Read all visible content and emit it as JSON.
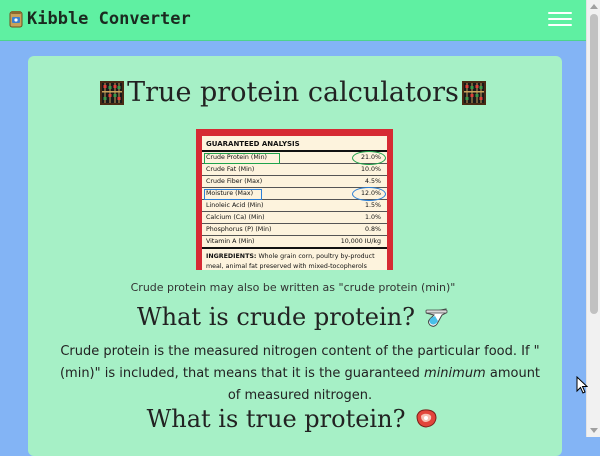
{
  "app": {
    "brand": "Kibble Converter",
    "brand_icon": "kibble-bag-icon",
    "menu_icon": "hamburger-menu-icon"
  },
  "colors": {
    "background": "#83b4f5",
    "navbar": "#5ff0a2",
    "card": "#a6f0c6",
    "label_border": "#d62a33",
    "highlight_green": "#1fa24b",
    "highlight_blue": "#2b7fd6"
  },
  "main": {
    "title": "True protein calculators",
    "title_icon": "abacus-icon",
    "label_image": {
      "heading": "GUARANTEED ANALYSIS",
      "rows": [
        {
          "name": "Crude Protein (Min)",
          "value": "21.0%"
        },
        {
          "name": "Crude Fat (Min)",
          "value": "10.0%"
        },
        {
          "name": "Crude Fiber (Max)",
          "value": "4.5%"
        },
        {
          "name": "Moisture (Max)",
          "value": "12.0%"
        },
        {
          "name": "Linoleic Acid (Min)",
          "value": "1.5%"
        },
        {
          "name": "Calcium (Ca) (Min)",
          "value": "1.0%"
        },
        {
          "name": "Phosphorus (P) (Min)",
          "value": "0.8%"
        },
        {
          "name": "Vitamin A (Min)",
          "value": "10,000 IU/kg"
        }
      ],
      "ingredients_label": "INGREDIENTS:",
      "ingredients_text": "Whole grain corn, poultry by-product meal, animal fat preserved with mixed-tocopherols (form of Vitamin E), corn gluten meal, meat and bone meal,"
    },
    "caption": "Crude protein may also be written as \"crude protein (min)\"",
    "section1": {
      "heading": "What is crude protein?",
      "icon": "test-tube-icon",
      "para_before": "Crude protein is the measured nitrogen content of the particular food. If \"(min)\" is included, that means that it is the guaranteed ",
      "para_em": "minimum",
      "para_after": " amount of measured nitrogen."
    },
    "section2": {
      "heading": "What is true protein?",
      "icon": "meat-icon"
    }
  }
}
